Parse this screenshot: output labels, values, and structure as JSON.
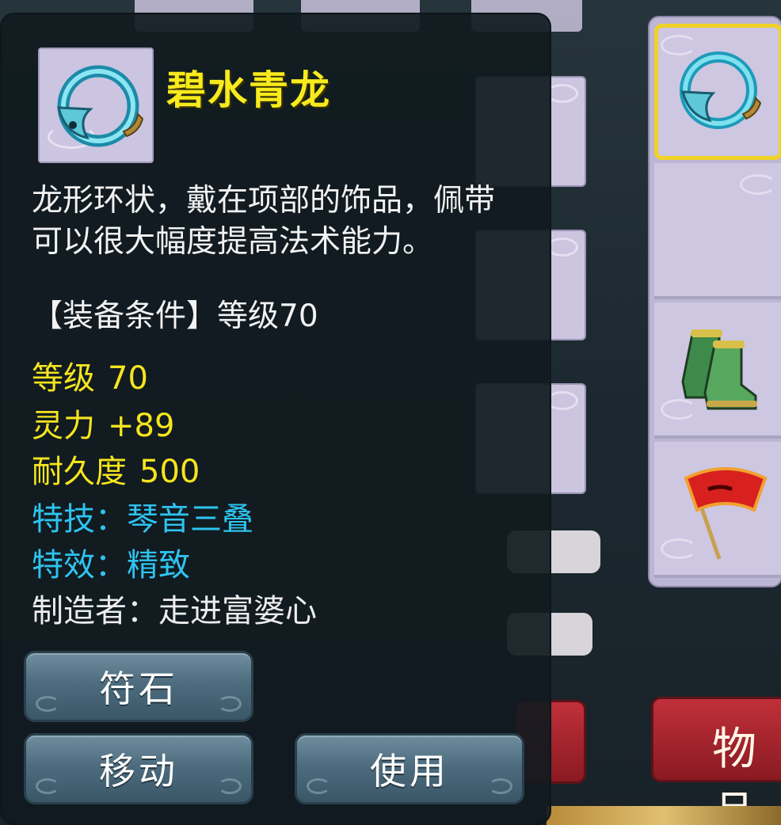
{
  "item": {
    "name": "碧水青龙",
    "icon": "dragon-ring-icon",
    "description": "龙形环状，戴在项部的饰品，佩带可以很大幅度提高法术能力。",
    "requirement": "【装备条件】等级70"
  },
  "stats": [
    {
      "label": "等级",
      "value": "70",
      "color": "#f5e51e"
    },
    {
      "label": "灵力",
      "value": "+89",
      "color": "#f5e51e"
    },
    {
      "label": "耐久度",
      "value": "500",
      "color": "#f5e51e"
    }
  ],
  "specials": [
    {
      "text": "特技：琴音三叠",
      "color": "#2ec4f0"
    },
    {
      "text": "特效：精致",
      "color": "#2ec4f0"
    }
  ],
  "maker": "制造者：走进富婆心",
  "buttons": {
    "rune": "符石",
    "move": "移动",
    "use": "使用"
  },
  "background": {
    "item_button": "物品",
    "inventory_icons": [
      "dragon-ring-icon",
      "boots-icon",
      "fan-weapon-icon"
    ]
  },
  "colors": {
    "name": "#f7ea1d",
    "stat": "#f5e51e",
    "special": "#2ec4f0",
    "selection": "#f1d228",
    "panel": "#101a1f"
  }
}
